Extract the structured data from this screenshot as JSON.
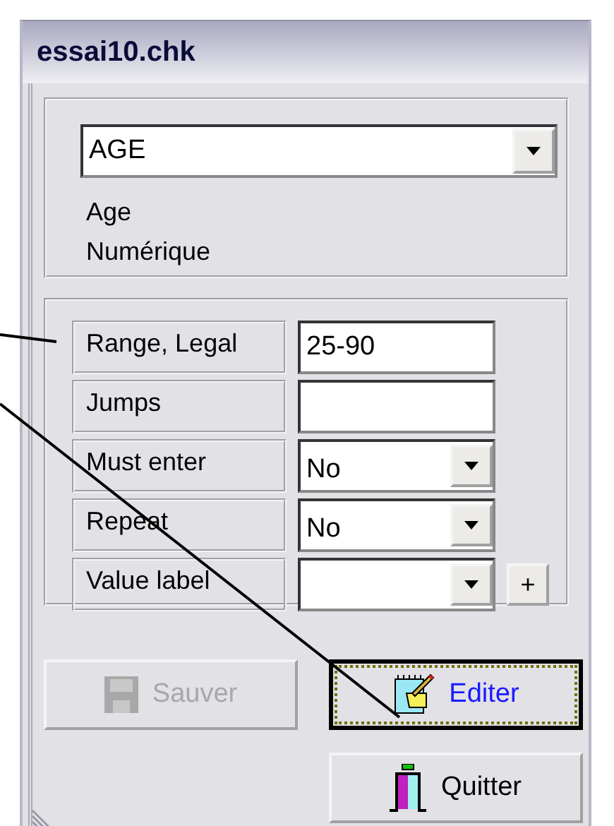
{
  "window": {
    "title": "essai10.chk"
  },
  "variable": {
    "selector": {
      "value": "AGE"
    },
    "label": "Age",
    "type": "Numérique"
  },
  "properties": [
    {
      "kind": "text",
      "label": "Range, Legal",
      "value": "25-90"
    },
    {
      "kind": "text",
      "label": "Jumps"
    },
    {
      "kind": "dropdown",
      "label": "Must enter",
      "value": "No"
    },
    {
      "kind": "dropdown",
      "label": "Repeat",
      "value": "No"
    },
    {
      "kind": "dropdown",
      "label": "Value label",
      "add_button": "+"
    }
  ],
  "buttons": [
    {
      "kind": "save",
      "label": "Sauver",
      "disabled": true,
      "focused": false
    },
    {
      "kind": "edit",
      "label": "Editer",
      "disabled": false,
      "focused": true
    },
    {
      "kind": "quit",
      "label": "Quitter",
      "disabled": false,
      "focused": false
    }
  ]
}
